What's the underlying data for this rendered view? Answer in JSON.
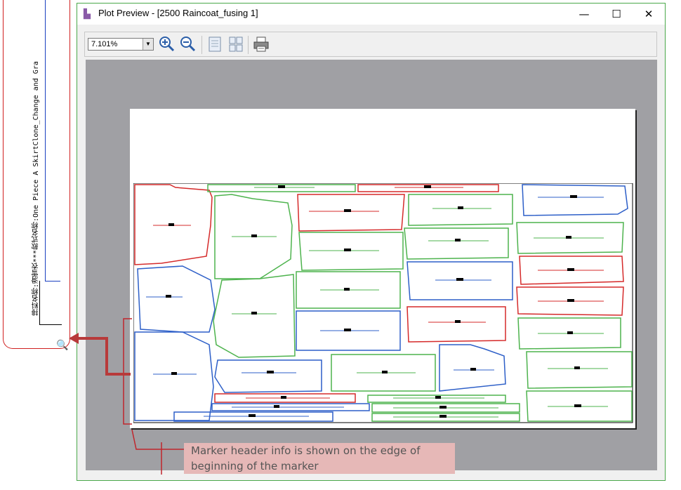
{
  "marker_header": {
    "text_main": "Marker Name:Ref01***Style Name:One Piece A SkirtClone_Change and Gra",
    "text_prefix": "排料名称:滑雪衣***",
    "text_suffix": "款式名称:One Piece A SkirtClone_Change and Gra"
  },
  "window": {
    "title": "Plot Preview - [2500 Raincoat_fusing 1]",
    "minimize_glyph": "—",
    "maximize_glyph": "☐",
    "close_glyph": "✕"
  },
  "toolbar": {
    "zoom_value": "7.101%",
    "zoom_arrow": "▼",
    "zoom_in_icon": "zoom-in-icon",
    "zoom_out_icon": "zoom-out-icon",
    "single_page_icon": "single-page-icon",
    "multi_page_icon": "multi-page-icon",
    "print_icon": "print-icon"
  },
  "annotation": {
    "line1": "Marker header info is shown on the edge of",
    "line2": "beginning of the marker"
  },
  "colors": {
    "red": "#d52a2a",
    "green": "#4db34d",
    "blue": "#2d5fc8",
    "canvas": "#a0a0a4",
    "annotation_bg": "#e6b8b7",
    "window_border": "#4aa84a"
  }
}
